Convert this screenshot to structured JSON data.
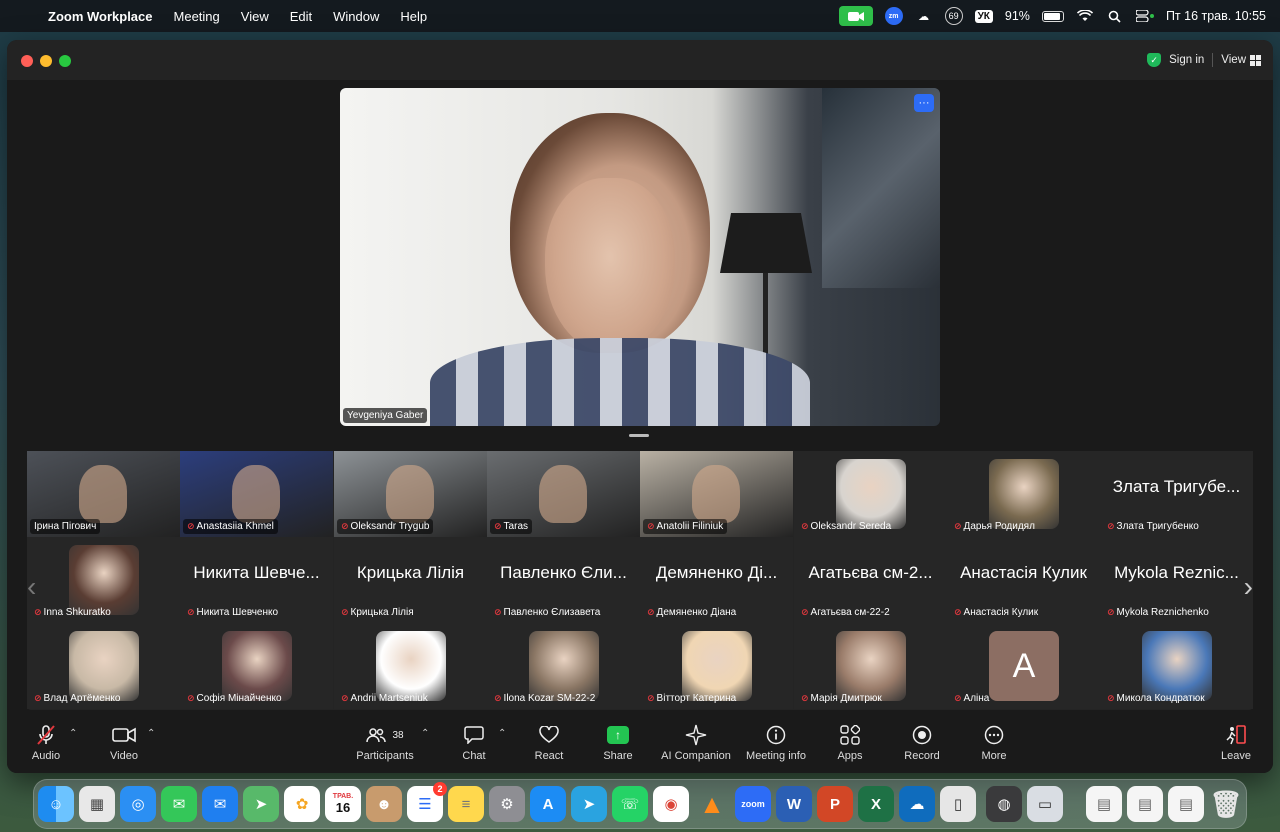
{
  "menubar": {
    "app_name": "Zoom Workplace",
    "menus": [
      "Meeting",
      "View",
      "Edit",
      "Window",
      "Help"
    ],
    "battery": "91%",
    "keyboard": "УК",
    "notification_count": "69",
    "datetime": "Пт 16 трав.  10:55"
  },
  "window": {
    "sign_in": "Sign in",
    "view": "View"
  },
  "speaker": {
    "name": "Yevgeniya Gaber",
    "more": "···"
  },
  "gallery": {
    "row1": [
      {
        "name": "Ірина Пігович",
        "muted": false,
        "kind": "video",
        "bg": "#4d5158"
      },
      {
        "name": "Anastasiia Khmel",
        "muted": true,
        "kind": "video",
        "bg": "#2c3e7d"
      },
      {
        "name": "Oleksandr Trygub",
        "muted": true,
        "kind": "video",
        "bg": "#8d9296"
      },
      {
        "name": "Taras",
        "muted": true,
        "kind": "video",
        "bg": "#6a6d70"
      },
      {
        "name": "Anatolii Filiniuk",
        "muted": true,
        "kind": "video",
        "bg": "#b9b1a4"
      },
      {
        "name": "Oleksandr Sereda",
        "muted": true,
        "kind": "avatar",
        "bg": "#d8d4cf"
      },
      {
        "name": "Дарья Родидял",
        "muted": true,
        "kind": "avatar",
        "bg": "#7a6a50"
      },
      {
        "name": "Злата Тригубенко",
        "muted": true,
        "kind": "text",
        "display": "Злата Тригубе..."
      }
    ],
    "row2": [
      {
        "name": "Inna Shkuratko",
        "muted": true,
        "kind": "avatar",
        "bg": "#5a3d33"
      },
      {
        "name": "Никита Шевченко",
        "muted": true,
        "kind": "text",
        "display": "Никита Шевче..."
      },
      {
        "name": "Крицька Лілія",
        "muted": true,
        "kind": "text",
        "display": "Крицька Лілія"
      },
      {
        "name": "Павленко Єлизавета",
        "muted": true,
        "kind": "text",
        "display": "Павленко Єли..."
      },
      {
        "name": "Демяненко Діана",
        "muted": true,
        "kind": "text",
        "display": "Демяненко Ді..."
      },
      {
        "name": "Агатьєва см-22-2",
        "muted": true,
        "kind": "text",
        "display": "Агатьєва см-2..."
      },
      {
        "name": "Анастасія Кулик",
        "muted": true,
        "kind": "text",
        "display": "Анастасія Кулик"
      },
      {
        "name": "Mykola Reznichenko",
        "muted": true,
        "kind": "text",
        "display": "Mykola Reznic..."
      }
    ],
    "row3": [
      {
        "name": "Влад Артёменко",
        "muted": true,
        "kind": "avatar",
        "bg": "#c8b9a6"
      },
      {
        "name": "Софія Мінайченко",
        "muted": true,
        "kind": "avatar",
        "bg": "#6b4a4a"
      },
      {
        "name": "Andrii Martseniuk",
        "muted": true,
        "kind": "avatar",
        "bg": "#ffffff"
      },
      {
        "name": "Ilona Kozar SM-22-2",
        "muted": true,
        "kind": "avatar",
        "bg": "#8a7664"
      },
      {
        "name": "Вітторт Катерина",
        "muted": true,
        "kind": "avatar",
        "bg": "#f0d6b3"
      },
      {
        "name": "Марія Дмитрюк",
        "muted": true,
        "kind": "avatar",
        "bg": "#9a7c6a"
      },
      {
        "name": "Аліна",
        "muted": true,
        "kind": "letter",
        "letter": "A",
        "bg": "#8c6e63"
      },
      {
        "name": "Микола Кондратюк",
        "muted": true,
        "kind": "avatar",
        "bg": "#4a78b8"
      }
    ]
  },
  "toolbar": {
    "audio": "Audio",
    "video": "Video",
    "participants": "Participants",
    "participants_count": "38",
    "chat": "Chat",
    "react": "React",
    "share": "Share",
    "ai_companion": "AI Companion",
    "meeting_info": "Meeting info",
    "apps": "Apps",
    "record": "Record",
    "more": "More",
    "leave": "Leave"
  },
  "dock": {
    "calendar_month": "ТРАВ.",
    "calendar_day": "16",
    "reminders_badge": "2",
    "zoom_label": "zoom"
  },
  "colors": {
    "accent_blue": "#2d6cf6",
    "muted_red": "#e0383e",
    "share_green": "#23c552",
    "leave_red": "#ff4d4f"
  }
}
